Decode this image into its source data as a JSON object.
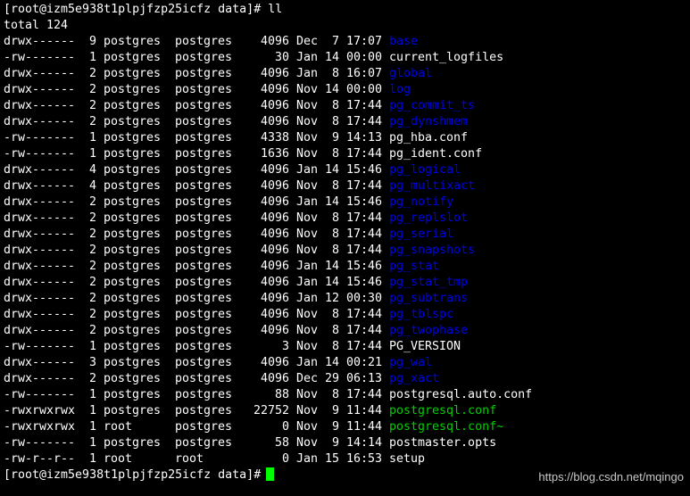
{
  "colors": {
    "background": "#000000",
    "text": "#ffffff",
    "directory": "#0000ee",
    "executable": "#00d000",
    "cursor": "#00ff00"
  },
  "top_command": "[root@izm5e938t1plpjfzp25icfz data]# ll",
  "total": "total 124",
  "entries": [
    {
      "perm": "drwx------",
      "links": "9",
      "owner": "postgres",
      "group": "postgres",
      "size": "4096",
      "month": "Dec",
      "day": "7",
      "time": "17:07",
      "name": "base",
      "type": "dir"
    },
    {
      "perm": "-rw-------",
      "links": "1",
      "owner": "postgres",
      "group": "postgres",
      "size": "30",
      "month": "Jan",
      "day": "14",
      "time": "00:00",
      "name": "current_logfiles",
      "type": "file"
    },
    {
      "perm": "drwx------",
      "links": "2",
      "owner": "postgres",
      "group": "postgres",
      "size": "4096",
      "month": "Jan",
      "day": "8",
      "time": "16:07",
      "name": "global",
      "type": "dir"
    },
    {
      "perm": "drwx------",
      "links": "2",
      "owner": "postgres",
      "group": "postgres",
      "size": "4096",
      "month": "Nov",
      "day": "14",
      "time": "00:00",
      "name": "log",
      "type": "dir"
    },
    {
      "perm": "drwx------",
      "links": "2",
      "owner": "postgres",
      "group": "postgres",
      "size": "4096",
      "month": "Nov",
      "day": "8",
      "time": "17:44",
      "name": "pg_commit_ts",
      "type": "dir"
    },
    {
      "perm": "drwx------",
      "links": "2",
      "owner": "postgres",
      "group": "postgres",
      "size": "4096",
      "month": "Nov",
      "day": "8",
      "time": "17:44",
      "name": "pg_dynshmem",
      "type": "dir"
    },
    {
      "perm": "-rw-------",
      "links": "1",
      "owner": "postgres",
      "group": "postgres",
      "size": "4338",
      "month": "Nov",
      "day": "9",
      "time": "14:13",
      "name": "pg_hba.conf",
      "type": "file"
    },
    {
      "perm": "-rw-------",
      "links": "1",
      "owner": "postgres",
      "group": "postgres",
      "size": "1636",
      "month": "Nov",
      "day": "8",
      "time": "17:44",
      "name": "pg_ident.conf",
      "type": "file"
    },
    {
      "perm": "drwx------",
      "links": "4",
      "owner": "postgres",
      "group": "postgres",
      "size": "4096",
      "month": "Jan",
      "day": "14",
      "time": "15:46",
      "name": "pg_logical",
      "type": "dir"
    },
    {
      "perm": "drwx------",
      "links": "4",
      "owner": "postgres",
      "group": "postgres",
      "size": "4096",
      "month": "Nov",
      "day": "8",
      "time": "17:44",
      "name": "pg_multixact",
      "type": "dir"
    },
    {
      "perm": "drwx------",
      "links": "2",
      "owner": "postgres",
      "group": "postgres",
      "size": "4096",
      "month": "Jan",
      "day": "14",
      "time": "15:46",
      "name": "pg_notify",
      "type": "dir"
    },
    {
      "perm": "drwx------",
      "links": "2",
      "owner": "postgres",
      "group": "postgres",
      "size": "4096",
      "month": "Nov",
      "day": "8",
      "time": "17:44",
      "name": "pg_replslot",
      "type": "dir"
    },
    {
      "perm": "drwx------",
      "links": "2",
      "owner": "postgres",
      "group": "postgres",
      "size": "4096",
      "month": "Nov",
      "day": "8",
      "time": "17:44",
      "name": "pg_serial",
      "type": "dir"
    },
    {
      "perm": "drwx------",
      "links": "2",
      "owner": "postgres",
      "group": "postgres",
      "size": "4096",
      "month": "Nov",
      "day": "8",
      "time": "17:44",
      "name": "pg_snapshots",
      "type": "dir"
    },
    {
      "perm": "drwx------",
      "links": "2",
      "owner": "postgres",
      "group": "postgres",
      "size": "4096",
      "month": "Jan",
      "day": "14",
      "time": "15:46",
      "name": "pg_stat",
      "type": "dir"
    },
    {
      "perm": "drwx------",
      "links": "2",
      "owner": "postgres",
      "group": "postgres",
      "size": "4096",
      "month": "Jan",
      "day": "14",
      "time": "15:46",
      "name": "pg_stat_tmp",
      "type": "dir"
    },
    {
      "perm": "drwx------",
      "links": "2",
      "owner": "postgres",
      "group": "postgres",
      "size": "4096",
      "month": "Jan",
      "day": "12",
      "time": "00:30",
      "name": "pg_subtrans",
      "type": "dir"
    },
    {
      "perm": "drwx------",
      "links": "2",
      "owner": "postgres",
      "group": "postgres",
      "size": "4096",
      "month": "Nov",
      "day": "8",
      "time": "17:44",
      "name": "pg_tblspc",
      "type": "dir"
    },
    {
      "perm": "drwx------",
      "links": "2",
      "owner": "postgres",
      "group": "postgres",
      "size": "4096",
      "month": "Nov",
      "day": "8",
      "time": "17:44",
      "name": "pg_twophase",
      "type": "dir"
    },
    {
      "perm": "-rw-------",
      "links": "1",
      "owner": "postgres",
      "group": "postgres",
      "size": "3",
      "month": "Nov",
      "day": "8",
      "time": "17:44",
      "name": "PG_VERSION",
      "type": "file"
    },
    {
      "perm": "drwx------",
      "links": "3",
      "owner": "postgres",
      "group": "postgres",
      "size": "4096",
      "month": "Jan",
      "day": "14",
      "time": "00:21",
      "name": "pg_wal",
      "type": "dir"
    },
    {
      "perm": "drwx------",
      "links": "2",
      "owner": "postgres",
      "group": "postgres",
      "size": "4096",
      "month": "Dec",
      "day": "29",
      "time": "06:13",
      "name": "pg_xact",
      "type": "dir"
    },
    {
      "perm": "-rw-------",
      "links": "1",
      "owner": "postgres",
      "group": "postgres",
      "size": "88",
      "month": "Nov",
      "day": "8",
      "time": "17:44",
      "name": "postgresql.auto.conf",
      "type": "file"
    },
    {
      "perm": "-rwxrwxrwx",
      "links": "1",
      "owner": "postgres",
      "group": "postgres",
      "size": "22752",
      "month": "Nov",
      "day": "9",
      "time": "11:44",
      "name": "postgresql.conf",
      "type": "exec"
    },
    {
      "perm": "-rwxrwxrwx",
      "links": "1",
      "owner": "root",
      "group": "postgres",
      "size": "0",
      "month": "Nov",
      "day": "9",
      "time": "11:44",
      "name": "postgresql.conf~",
      "type": "exec"
    },
    {
      "perm": "-rw-------",
      "links": "1",
      "owner": "postgres",
      "group": "postgres",
      "size": "58",
      "month": "Nov",
      "day": "9",
      "time": "14:14",
      "name": "postmaster.opts",
      "type": "file"
    },
    {
      "perm": "-rw-r--r--",
      "links": "1",
      "owner": "root",
      "group": "root",
      "size": "0",
      "month": "Jan",
      "day": "15",
      "time": "16:53",
      "name": "setup",
      "type": "file"
    }
  ],
  "bottom_prompt": "[root@izm5e938t1plpjfzp25icfz data]#",
  "watermark": "https://blog.csdn.net/mqingo"
}
